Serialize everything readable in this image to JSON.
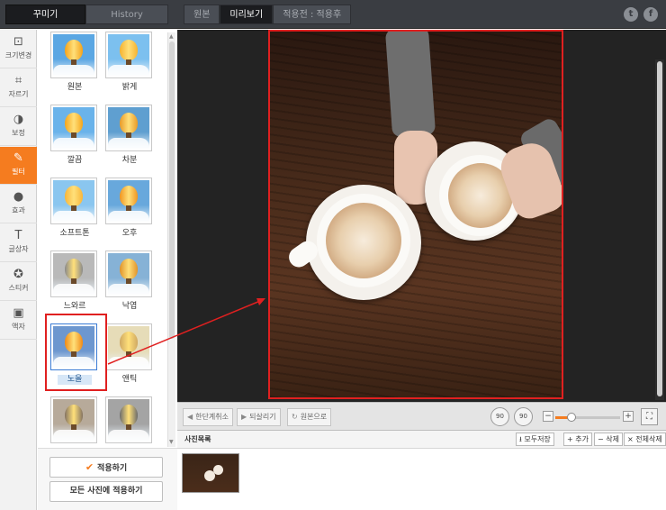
{
  "panel_tabs": {
    "decorate": "꾸미기",
    "history": "History"
  },
  "view_tabs": {
    "original": "원본",
    "preview": "미리보기",
    "before_after": "적용전 : 적용후"
  },
  "social": {
    "twitter": "t",
    "facebook": "f"
  },
  "tools": [
    {
      "label": "크기변경",
      "icon": "resize-icon",
      "glyph": "⊡"
    },
    {
      "label": "자르기",
      "icon": "crop-icon",
      "glyph": "⌗"
    },
    {
      "label": "보정",
      "icon": "contrast-icon",
      "glyph": "◑"
    },
    {
      "label": "필터",
      "icon": "wand-icon",
      "glyph": "✎"
    },
    {
      "label": "효과",
      "icon": "drop-icon",
      "glyph": "●"
    },
    {
      "label": "글상자",
      "icon": "text-icon",
      "glyph": "T"
    },
    {
      "label": "스티커",
      "icon": "star-icon",
      "glyph": "✪"
    },
    {
      "label": "액자",
      "icon": "frame-icon",
      "glyph": "▣"
    }
  ],
  "active_tool": "필터",
  "filters": [
    {
      "name": "원본",
      "sky": "#5ba7e3",
      "balloon": "#f4a21a"
    },
    {
      "name": "밝게",
      "sky": "#7cc0ef",
      "balloon": "#f6b22f"
    },
    {
      "name": "깔끔",
      "sky": "#6ab3ea",
      "balloon": "#f5a51c"
    },
    {
      "name": "차분",
      "sky": "#5f9fd0",
      "balloon": "#e99a28"
    },
    {
      "name": "소프트톤",
      "sky": "#8ac6ef",
      "balloon": "#f7b63a"
    },
    {
      "name": "오후",
      "sky": "#68a8dc",
      "balloon": "#f09520"
    },
    {
      "name": "느와르",
      "sky": "#b9b9b9",
      "balloon": "#8a8a8a"
    },
    {
      "name": "낙엽",
      "sky": "#86b2d6",
      "balloon": "#e0932a"
    },
    {
      "name": "노을",
      "sky": "#6d97cf",
      "balloon": "#f08a16"
    },
    {
      "name": "앤틱",
      "sky": "#e6dcb8",
      "balloon": "#cfa862"
    },
    {
      "name": "",
      "sky": "#b7aa9a",
      "balloon": "#857462"
    },
    {
      "name": "",
      "sky": "#a4a4a4",
      "balloon": "#6c6c6c"
    }
  ],
  "selected_filter": "노을",
  "apply": {
    "apply_label": "적용하기",
    "apply_all_label": "모든 사진에 적용하기"
  },
  "toolbar": {
    "undo": "한단계취소",
    "redo": "되살리기",
    "reset": "원본으로",
    "rotate_left": "90",
    "rotate_right": "90",
    "zoom_minus": "−",
    "zoom_plus": "+",
    "zoom_level": 0.25
  },
  "photo_list": {
    "title": "사진목록",
    "save_all": "모두저장",
    "add": "+ 추가",
    "remove": "− 삭제",
    "remove_all": "× 전체삭제"
  },
  "colors": {
    "accent": "#f57c1f",
    "highlight_red": "#e02020",
    "topbar": "#3a3d42"
  }
}
